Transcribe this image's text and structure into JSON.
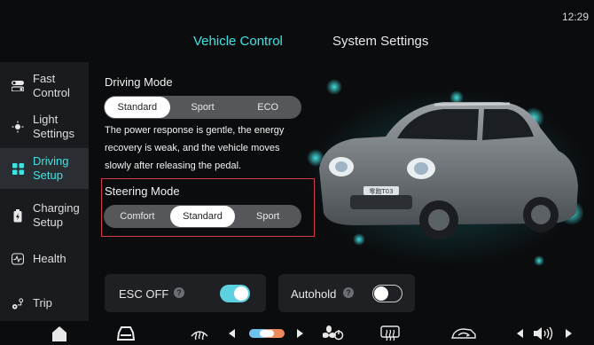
{
  "status": {
    "time": "12:29"
  },
  "tabs": {
    "vehicle_control": "Vehicle Control",
    "system_settings": "System Settings"
  },
  "sidebar": {
    "items": [
      {
        "label": "Fast\nControl",
        "icon": "toggle-switches-icon"
      },
      {
        "label": "Light\nSettings",
        "icon": "light-bulb-icon"
      },
      {
        "label": "Driving\nSetup",
        "icon": "driving-setup-icon",
        "active": true
      },
      {
        "label": "Charging\nSetup",
        "icon": "battery-charging-icon"
      },
      {
        "label": "Health",
        "icon": "health-pulse-icon"
      },
      {
        "label": "Trip",
        "icon": "trip-route-icon"
      }
    ]
  },
  "driving_mode": {
    "title": "Driving Mode",
    "options": [
      "Standard",
      "Sport",
      "ECO"
    ],
    "selected": "Standard",
    "description": "The power response is gentle, the energy recovery is weak, and the vehicle moves slowly after releasing the pedal."
  },
  "steering_mode": {
    "title": "Steering Mode",
    "options": [
      "Comfort",
      "Standard",
      "Sport"
    ],
    "selected": "Standard"
  },
  "esc": {
    "label": "ESC OFF",
    "help": "?",
    "enabled": true
  },
  "autohold": {
    "label": "Autohold",
    "help": "?",
    "enabled": false
  },
  "car": {
    "plate": "零跑T03"
  },
  "colors": {
    "accent": "#3fe3e3",
    "highlight_border": "#d33b4b",
    "toggle_on": "#5ccfe0"
  },
  "bottom_bar": {
    "icons": [
      "home-icon",
      "car-icon",
      "rear-defrost-icon",
      "temp-left-arrow-icon",
      "temperature-slider-icon",
      "temp-right-arrow-icon",
      "fan-power-icon",
      "front-defrost-icon",
      "car-recirculation-icon",
      "volume-down-arrow-icon",
      "volume-icon",
      "volume-up-arrow-icon"
    ]
  }
}
